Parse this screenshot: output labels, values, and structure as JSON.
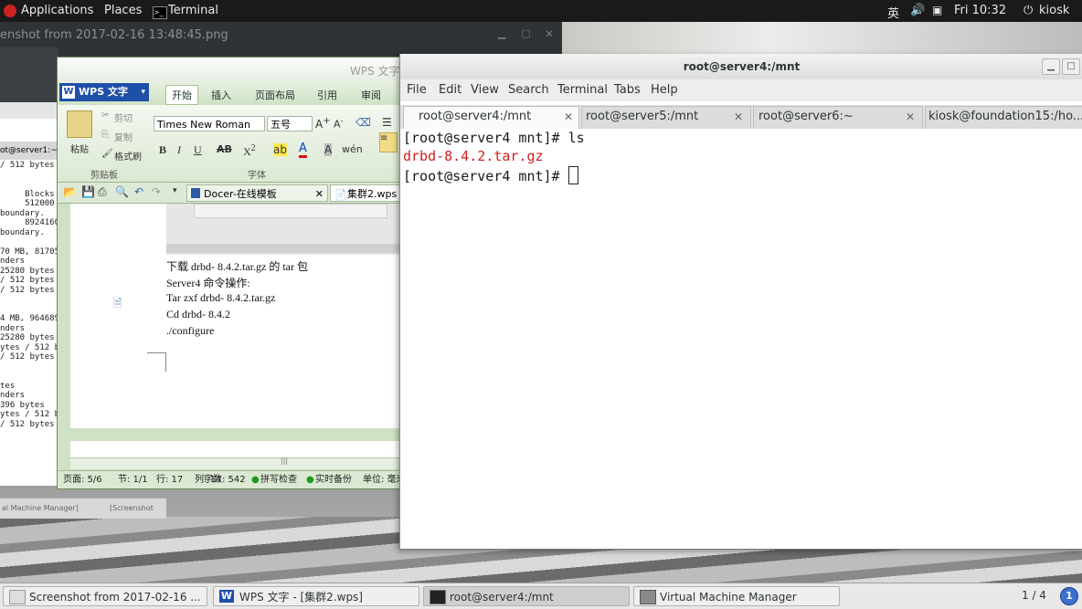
{
  "top_panel": {
    "applications": "Applications",
    "places": "Places",
    "terminal": "Terminal",
    "ime": "英",
    "clock": "Fri 10:32",
    "user": "kiosk"
  },
  "background": {
    "viewer_title": "enshot from 2017-02-16 13:48:45.png",
    "server1_tab": "ot@server1:~",
    "server1_lines": [
      "/ 512 bytes",
      "",
      "",
      "     Blocks",
      "     512000",
      "boundary.",
      "     8924160",
      "boundary.",
      "",
      "70 MB, 817056",
      "nders",
      "25280 bytes",
      "/ 512 bytes",
      "/ 512 bytes",
      "",
      "",
      "4 MB, 964689",
      "nders",
      "25280 bytes",
      "ytes / 512 by",
      "/ 512 bytes",
      "",
      "",
      "tes",
      "nders",
      "396 bytes",
      "ytes / 512 by",
      "/ 512 bytes"
    ],
    "vm_strip": "al Machine Manager]",
    "vm_strip_2": "[Screenshot"
  },
  "wps": {
    "title": "WPS 文字",
    "logo": "WPS 文字",
    "menu_tabs": [
      "开始",
      "插入",
      "页面布局",
      "引用",
      "审阅"
    ],
    "ribbon": {
      "paste": "粘贴",
      "cut": "剪切",
      "copy": "复制",
      "format_painter": "格式刷",
      "clipboard_group": "剪贴板",
      "font_name": "Times New Roman",
      "font_size": "五号",
      "font_group": "字体"
    },
    "doc_tabs": [
      "Docer-在线模板",
      "集群2.wps"
    ],
    "doc_lines": [
      "下载 drbd- 8.4.2.tar.gz 的 tar 包",
      "Server4 命令操作:",
      "Tar zxf drbd- 8.4.2.tar.gz",
      "Cd drbd- 8.4.2",
      "./configure"
    ],
    "status": {
      "page": "页面: 5/6",
      "section": "节: 1/1",
      "row": "行: 17",
      "col": "列: 14",
      "chars": "字数: 542",
      "spell": "拼写检查",
      "backup": "实时备份",
      "unit": "单位: 毫米"
    }
  },
  "terminal": {
    "title": "root@server4:/mnt",
    "menu": [
      "File",
      "Edit",
      "View",
      "Search",
      "Terminal",
      "Tabs",
      "Help"
    ],
    "tabs": [
      "root@server4:/mnt",
      "root@server5:/mnt",
      "root@server6:~",
      "kiosk@foundation15:/ho..."
    ],
    "lines": [
      {
        "text": "[root@server4 mnt]# ls",
        "color": "default"
      },
      {
        "text": "drbd-8.4.2.tar.gz",
        "color": "red"
      },
      {
        "text": "[root@server4 mnt]# ",
        "color": "default"
      }
    ]
  },
  "taskbar": {
    "items": [
      "Screenshot from 2017-02-16 ...",
      "WPS 文字 - [集群2.wps]",
      "root@server4:/mnt",
      "Virtual Machine Manager"
    ],
    "workspace": "1 / 4",
    "notification_count": "1"
  },
  "colors": {
    "terminal_red": "#d02020",
    "wps_green": "#cfe2c4",
    "wps_blue": "#1f4fa8"
  }
}
